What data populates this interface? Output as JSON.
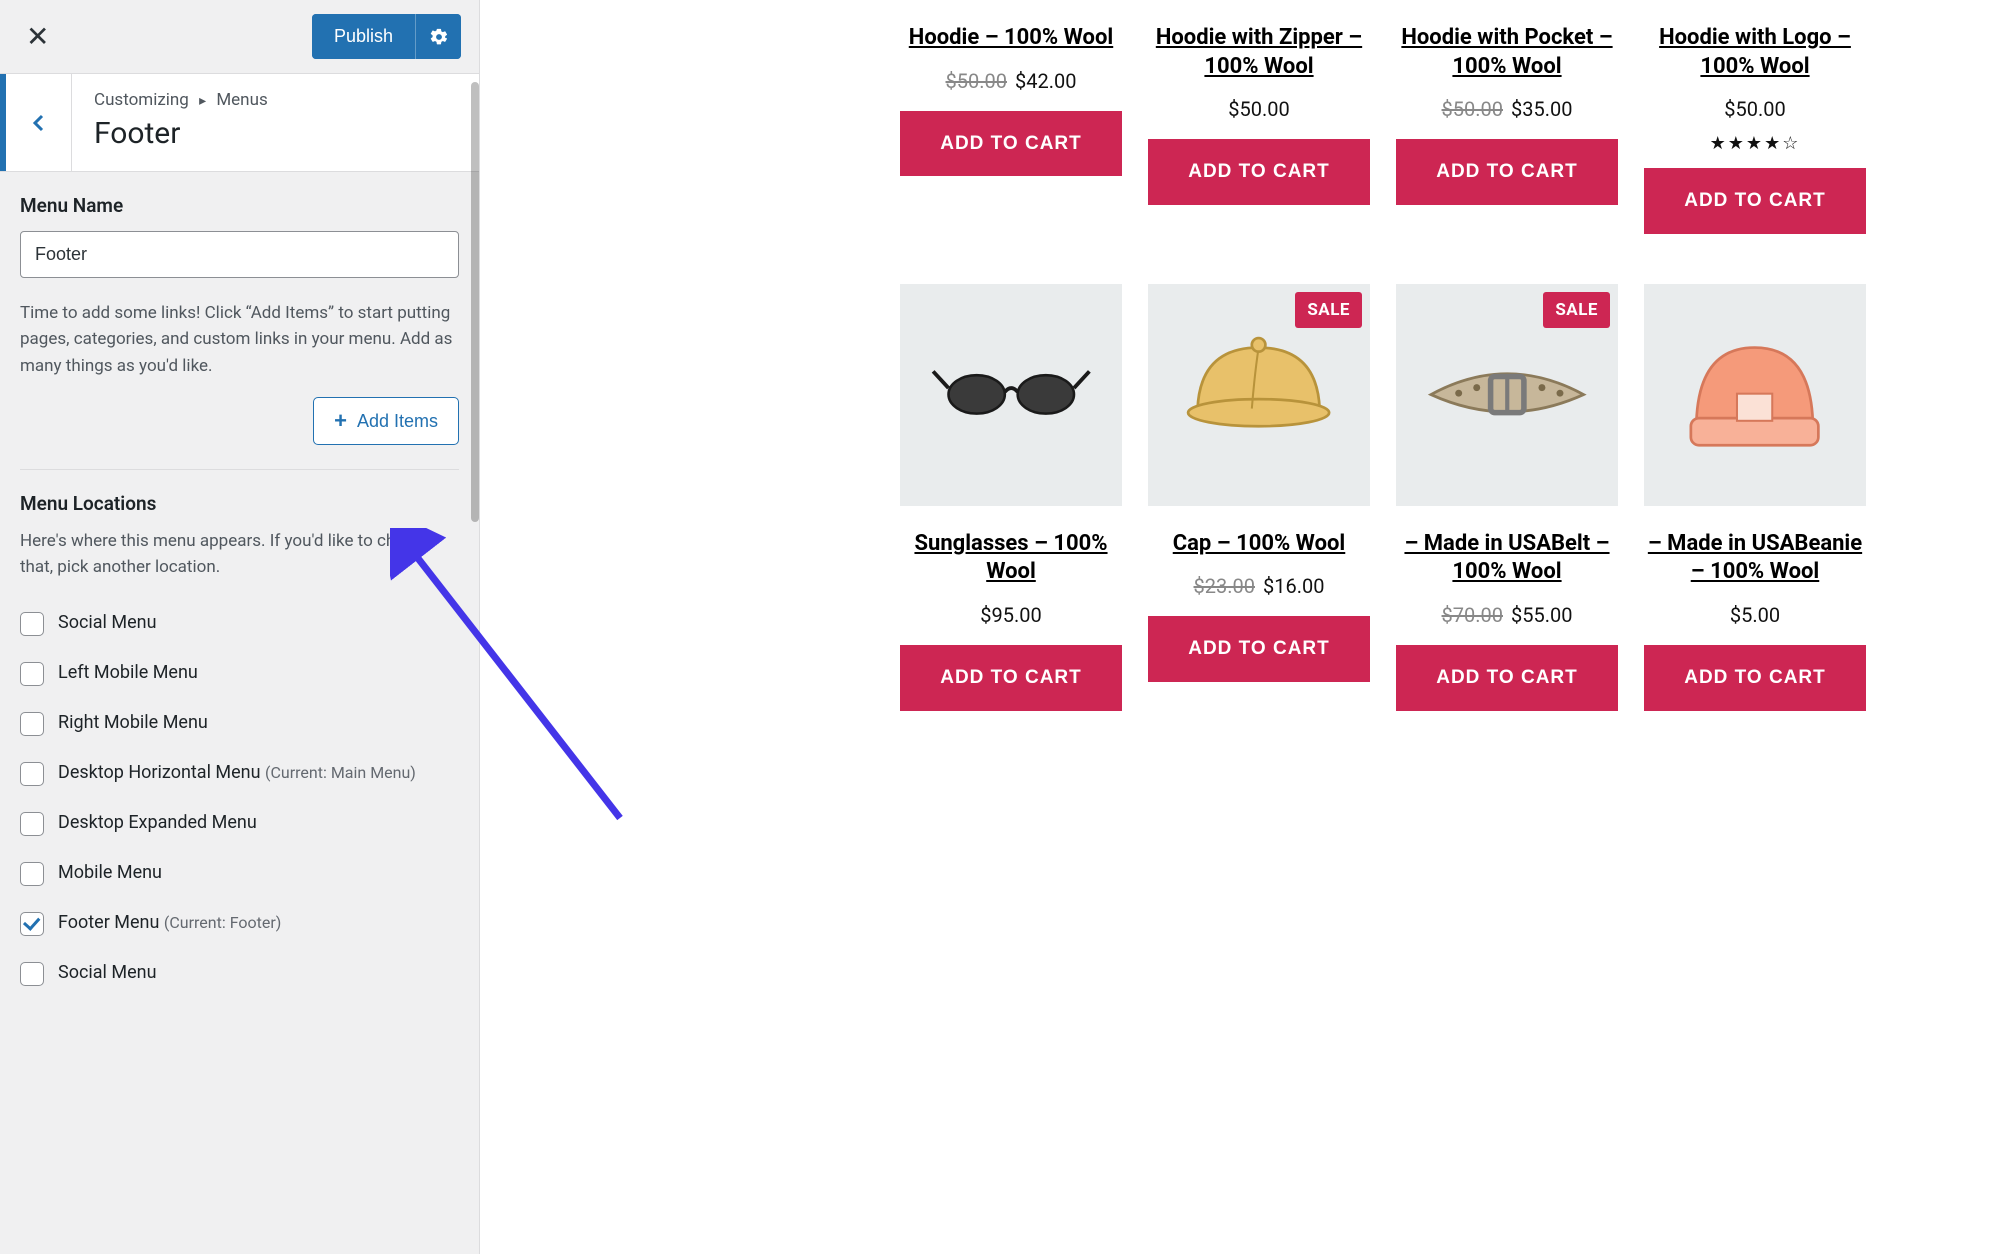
{
  "customizer": {
    "publish_label": "Publish",
    "breadcrumb_root": "Customizing",
    "breadcrumb_leaf": "Menus",
    "section_title": "Footer",
    "menu_name_label": "Menu Name",
    "menu_name_value": "Footer",
    "help_text": "Time to add some links! Click “Add Items” to start putting pages, categories, and custom links in your menu. Add as many things as you'd like.",
    "add_items_label": "Add Items",
    "locations_label": "Menu Locations",
    "locations_sub": "Here's where this menu appears. If you'd like to change that, pick another location.",
    "locations": [
      {
        "label": "Social Menu",
        "hint": "",
        "checked": false
      },
      {
        "label": "Left Mobile Menu",
        "hint": "",
        "checked": false
      },
      {
        "label": "Right Mobile Menu",
        "hint": "",
        "checked": false
      },
      {
        "label": "Desktop Horizontal Menu",
        "hint": "(Current: Main Menu)",
        "checked": false
      },
      {
        "label": "Desktop Expanded Menu",
        "hint": "",
        "checked": false
      },
      {
        "label": "Mobile Menu",
        "hint": "",
        "checked": false
      },
      {
        "label": "Footer Menu",
        "hint": "(Current: Footer)",
        "checked": true
      },
      {
        "label": "Social Menu",
        "hint": "",
        "checked": false
      }
    ]
  },
  "shop": {
    "sale_badge": "SALE",
    "cart_label": "ADD TO CART",
    "row1": [
      {
        "title": "Hoodie – 100% Wool",
        "regular": "$50.00",
        "sale": "$42.00",
        "rating": ""
      },
      {
        "title": "Hoodie with Zipper – 100% Wool",
        "regular": "",
        "sale": "",
        "single": "$50.00",
        "rating": ""
      },
      {
        "title": "Hoodie with Pocket – 100% Wool",
        "regular": "$50.00",
        "sale": "$35.00",
        "rating": ""
      },
      {
        "title": "Hoodie with Logo – 100% Wool",
        "regular": "",
        "sale": "",
        "single": "$50.00",
        "rating": "★★★★☆"
      }
    ],
    "row2": [
      {
        "title": "Sunglasses – 100% Wool",
        "single": "$95.00",
        "sale_flag": false,
        "icon": "sunglasses"
      },
      {
        "title": "Cap – 100% Wool",
        "regular": "$23.00",
        "sale": "$16.00",
        "sale_flag": true,
        "icon": "cap"
      },
      {
        "title": "– Made in USABelt – 100% Wool",
        "regular": "$70.00",
        "sale": "$55.00",
        "sale_flag": true,
        "icon": "belt"
      },
      {
        "title": "– Made in USABeanie – 100% Wool",
        "single": "$5.00",
        "sale_flag": false,
        "icon": "beanie"
      }
    ]
  }
}
